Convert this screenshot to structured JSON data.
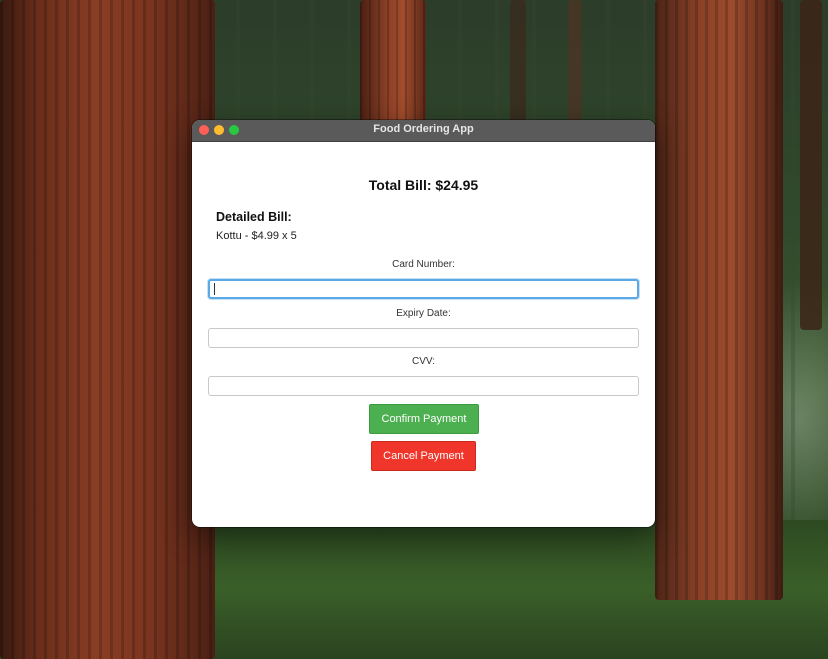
{
  "window": {
    "title": "Food Ordering App"
  },
  "bill": {
    "total_text": "Total Bill: $24.95",
    "detail_heading": "Detailed Bill:",
    "items": [
      "Kottu - $4.99 x 5"
    ]
  },
  "form": {
    "card_number_label": "Card Number:",
    "card_number_value": "",
    "expiry_label": "Expiry Date:",
    "expiry_value": "",
    "cvv_label": "CVV:",
    "cvv_value": ""
  },
  "buttons": {
    "confirm_label": "Confirm Payment",
    "cancel_label": "Cancel Payment"
  },
  "colors": {
    "confirm": "#4caf50",
    "cancel": "#f0352a",
    "focus_ring": "#5aa8e6",
    "titlebar": "#5a5a5a"
  },
  "icons": {
    "close": "close-dot-icon",
    "minimize": "minimize-dot-icon",
    "maximize": "maximize-dot-icon"
  }
}
